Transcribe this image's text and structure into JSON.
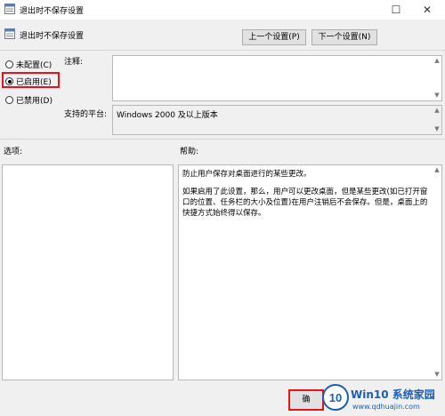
{
  "window": {
    "title": "退出时不保存设置"
  },
  "header": {
    "policy_title": "退出时不保存设置",
    "prev_button": "上一个设置(P)",
    "next_button": "下一个设置(N)"
  },
  "state": {
    "options": [
      {
        "label": "未配置(C)",
        "selected": false
      },
      {
        "label": "已启用(E)",
        "selected": true
      },
      {
        "label": "已禁用(D)",
        "selected": false
      }
    ]
  },
  "comment": {
    "label": "注释:",
    "value": ""
  },
  "platform": {
    "label": "支持的平台:",
    "value": "Windows 2000 及以上版本"
  },
  "sections": {
    "options_label": "选项:",
    "help_label": "帮助:"
  },
  "help": {
    "paragraphs": [
      "防止用户保存对桌面进行的某些更改。",
      "如果启用了此设置，那么，用户可以更改桌面，但是某些更改(如已打开窗口的位置、任务栏的大小及位置)在用户注销后不会保存。但是，桌面上的快捷方式始终得以保存。"
    ]
  },
  "footer": {
    "ok_button": "确"
  },
  "watermark": {
    "title": "Win10 系统家园",
    "url": "www.qdhuajin.com"
  },
  "colors": {
    "highlight": "#e8121c",
    "brand": "#1b5fb5"
  }
}
